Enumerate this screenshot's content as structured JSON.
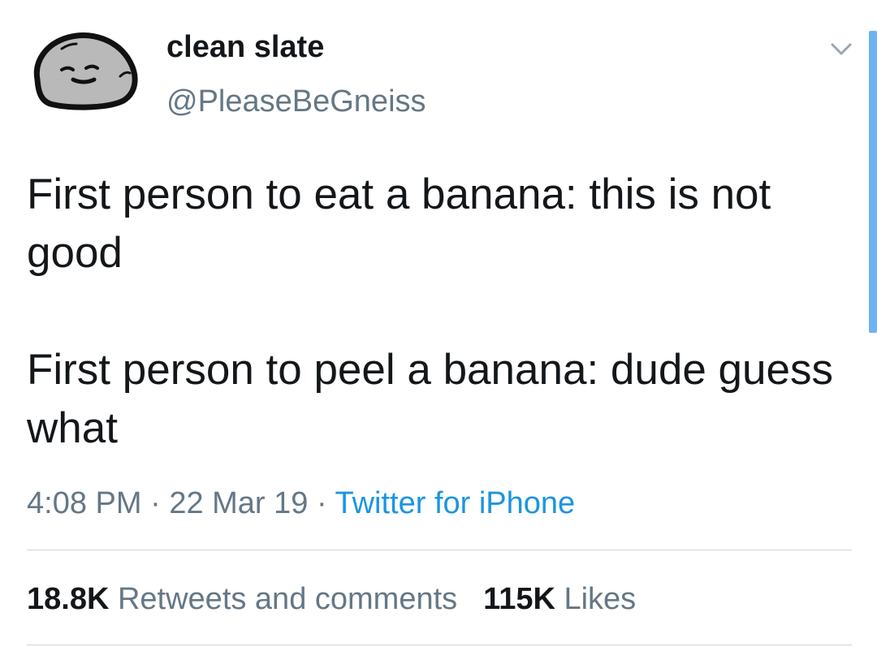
{
  "user": {
    "display_name": "clean slate",
    "handle": "@PleaseBeGneiss",
    "avatar_icon": "rock-face-avatar-icon"
  },
  "tweet": {
    "paragraphs": [
      "First person to eat a banana: this is not good",
      "First person to peel a banana: dude guess what"
    ],
    "time": "4:08 PM",
    "separator": " · ",
    "date": "22 Mar 19",
    "source": "Twitter for iPhone"
  },
  "stats": {
    "retweets_count": "18.8K",
    "retweets_label": "Retweets and comments",
    "likes_count": "115K",
    "likes_label": "Likes"
  },
  "icons": {
    "menu": "chevron-down-icon"
  },
  "colors": {
    "text": "#14171a",
    "secondary": "#657786",
    "link": "#1b95e0",
    "divider": "#ccd6dd",
    "scrollbar": "#6fb4ef"
  }
}
